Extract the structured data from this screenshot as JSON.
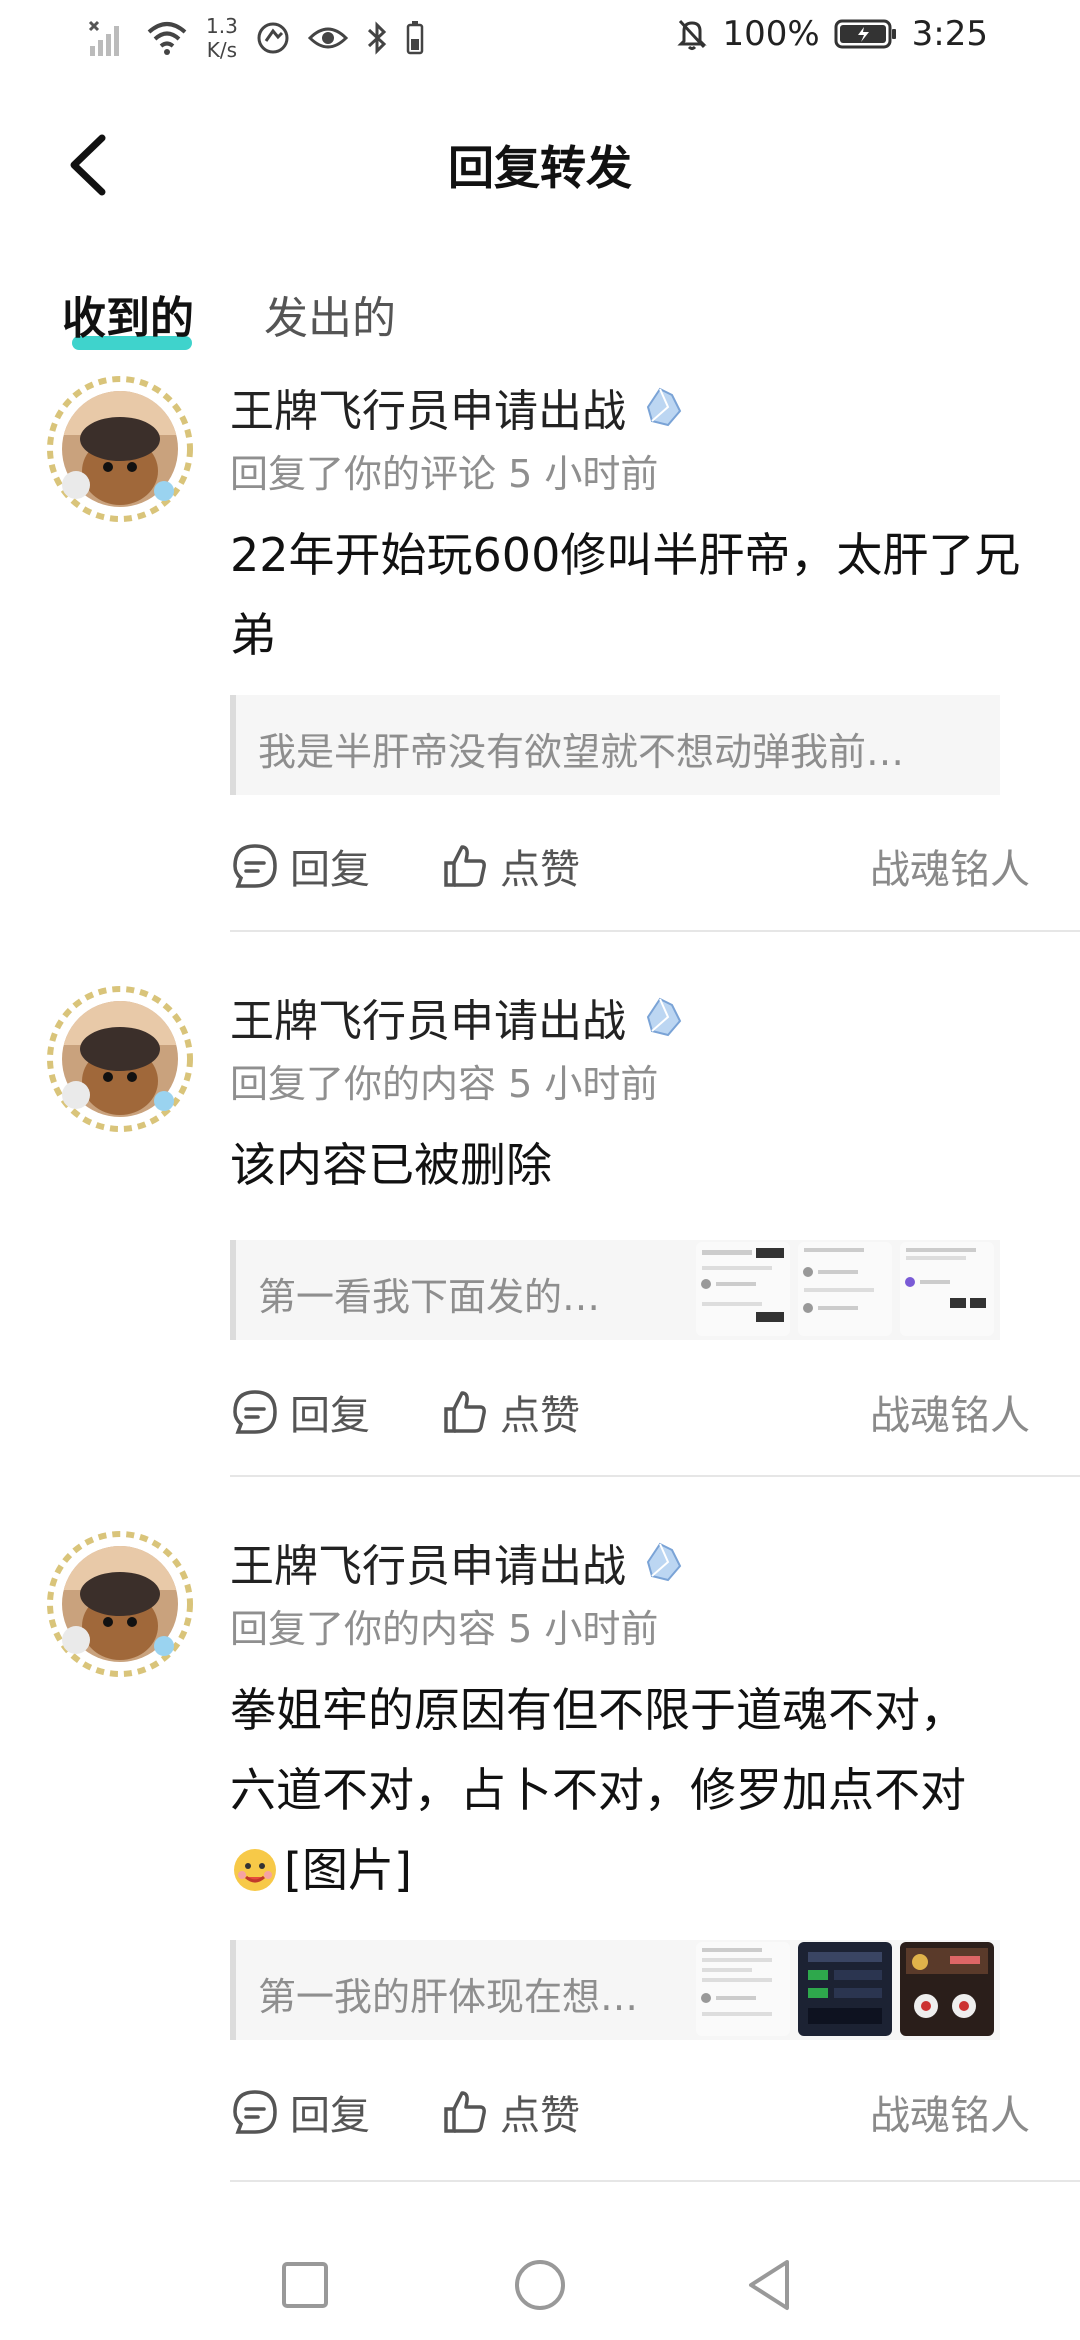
{
  "status_bar": {
    "network_speed_value": "1.3",
    "network_speed_unit": "K/s",
    "battery": "100%",
    "time": "3:25"
  },
  "header": {
    "title": "回复转发"
  },
  "tabs": [
    {
      "label": "收到的",
      "active": true
    },
    {
      "label": "发出的",
      "active": false
    }
  ],
  "posts": [
    {
      "author": "王牌飞行员申请出战",
      "action": "回复了你的评论",
      "time": "5 小时前",
      "content_line1": "22年开始玩600修叫半肝帝，太肝了兄",
      "content_line2": "弟",
      "quote": "我是半肝帝没有欲望就不想动弹我前…",
      "reply_label": "回复",
      "like_label": "点赞",
      "source": "战魂铭人"
    },
    {
      "author": "王牌飞行员申请出战",
      "action": "回复了你的内容",
      "time": "5 小时前",
      "content_line1": "该内容已被删除",
      "quote": "第一看我下面发的…",
      "reply_label": "回复",
      "like_label": "点赞",
      "source": "战魂铭人"
    },
    {
      "author": "王牌飞行员申请出战",
      "action": "回复了你的内容",
      "time": "5 小时前",
      "content_line1": "拳姐牢的原因有但不限于道魂不对，",
      "content_line2": "六道不对，占卜不对，修罗加点不对",
      "content_line3": "[图片]",
      "quote": "第一我的肝体现在想…",
      "reply_label": "回复",
      "like_label": "点赞",
      "source": "战魂铭人"
    }
  ],
  "colors": {
    "accent": "#3fd3cc",
    "meta_text": "#8f8f8f",
    "quote_bg": "#f6f6f6"
  }
}
